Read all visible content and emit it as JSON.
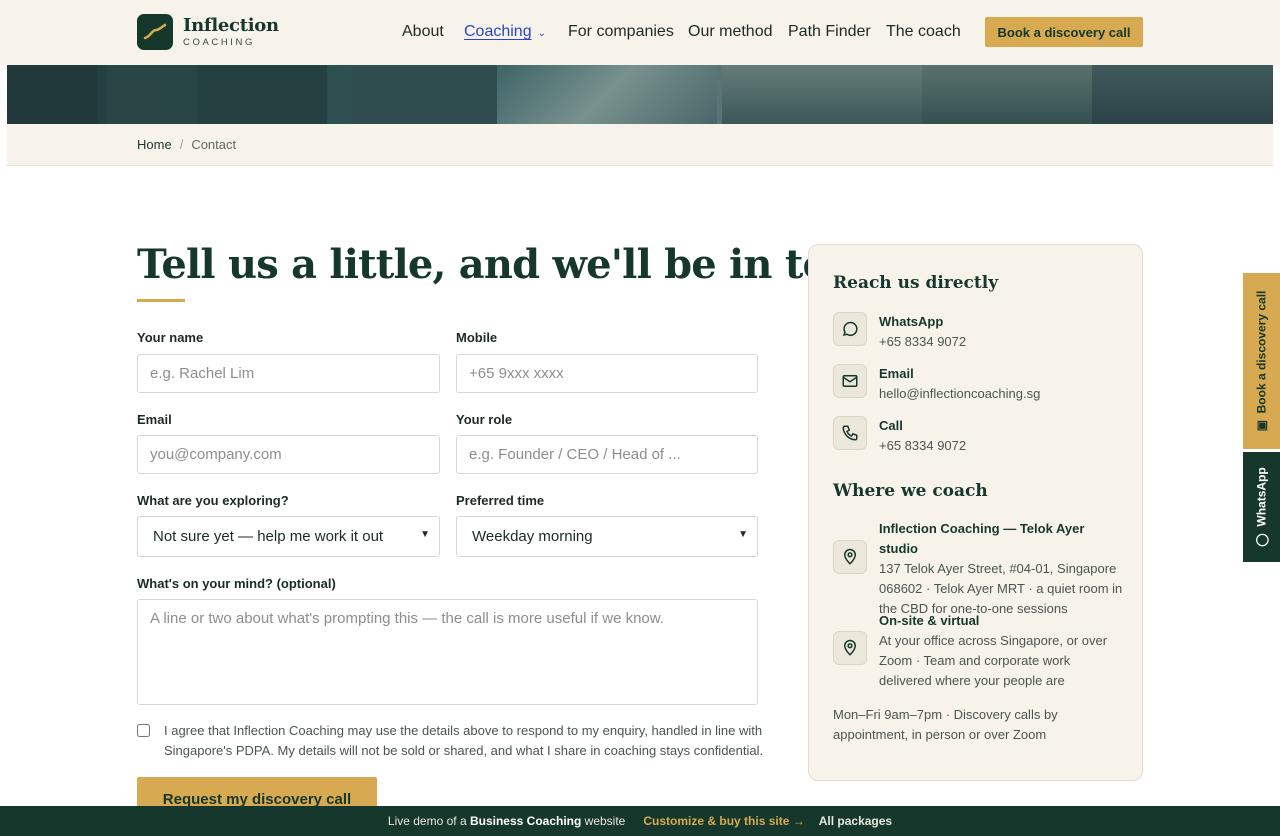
{
  "header": {
    "logo_name": "Inflection",
    "logo_sub": "COACHING",
    "nav": [
      "About",
      "Coaching",
      "For companies",
      "Our method",
      "Path Finder",
      "The coach"
    ],
    "cta": "Book a discovery call"
  },
  "breadcrumb": {
    "home": "Home",
    "separator": "/",
    "current": "Contact"
  },
  "form": {
    "title": "Tell us a little, and we'll be in touch",
    "name_label": "Your name",
    "name_placeholder": "e.g. Rachel Lim",
    "mobile_label": "Mobile",
    "mobile_placeholder": "+65 9xxx xxxx",
    "email_label": "Email",
    "email_placeholder": "you@company.com",
    "role_label": "Your role",
    "role_placeholder": "e.g. Founder / CEO / Head of ...",
    "exploring_label": "What are you exploring?",
    "exploring_value": "Not sure yet — help me work it out",
    "time_label": "Preferred time",
    "time_value": "Weekday morning",
    "mind_label": "What's on your mind? (optional)",
    "mind_placeholder": "A line or two about what's prompting this — the call is more useful if we know.",
    "consent": "I agree that Inflection Coaching may use the details above to respond to my enquiry, handled in line with Singapore's PDPA. My details will not be sold or shared, and what I share in coaching stays confidential.",
    "submit": "Request my discovery call"
  },
  "contact": {
    "reach_title": "Reach us directly",
    "whatsapp_label": "WhatsApp",
    "whatsapp_value": "+65 8334 9072",
    "email_label": "Email",
    "email_value": "hello@inflectioncoaching.sg",
    "call_label": "Call",
    "call_value": "+65 8334 9072",
    "where_title": "Where we coach",
    "studio_title": "Inflection Coaching — Telok Ayer studio",
    "studio_text": "137 Telok Ayer Street, #04-01, Singapore 068602 · Telok Ayer MRT · a quiet room in the CBD for one-to-one sessions",
    "onsite_title": "On-site & virtual",
    "onsite_text": "At your office across Singapore, or over Zoom · Team and corporate work delivered where your people are",
    "hours": "Mon–Fri 9am–7pm · Discovery calls by appointment, in person or over Zoom"
  },
  "side_tabs": {
    "book": "Book a discovery call",
    "whatsapp": "WhatsApp"
  },
  "bottom_bar": {
    "prefix": "Live demo of a",
    "highlight": "Business Coaching",
    "suffix": "website",
    "customize": "Customize & buy this site →",
    "packages": "All packages"
  },
  "colors": {
    "brand": "#16382c",
    "accent": "#d7a950",
    "cream": "#f7f3ea",
    "link": "#2a45c4"
  }
}
